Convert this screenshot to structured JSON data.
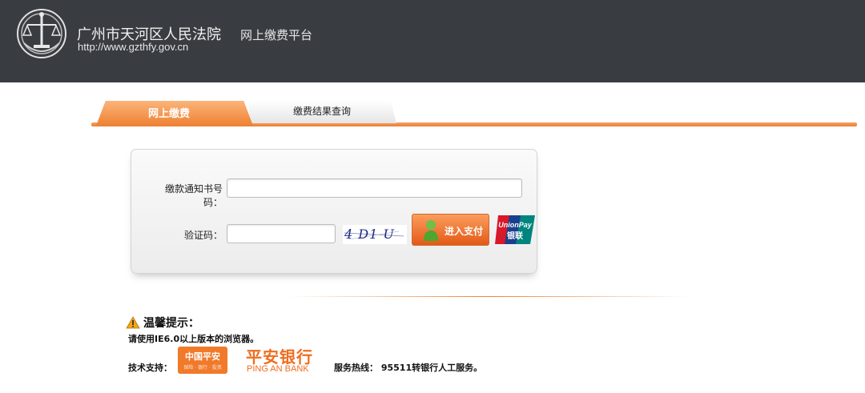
{
  "header": {
    "court_name": "广州市天河区人民法院",
    "platform_name": "网上缴费平台",
    "site_url": "http://www.gzthfy.gov.cn",
    "emblem_icon": "court-emblem-icon",
    "background": "#393c41"
  },
  "tabs": [
    {
      "label": "网上缴费",
      "active": true
    },
    {
      "label": "缴费结果查询",
      "active": false
    }
  ],
  "form": {
    "notice_label": "缴款通知书号码：",
    "notice_value": "",
    "captcha_label": "验证码：",
    "captcha_value": "",
    "captcha_text": "4 D1 U",
    "pay_button_label": "进入支付",
    "unionpay_line1": "UnionPay",
    "unionpay_line2": "银联"
  },
  "tips": {
    "title": "温馨提示：",
    "browser_note": "请使用IE6.0以上版本的浏览器。",
    "support_label": "技术支持：",
    "pingan_logo_text": "中国平安",
    "pingan_logo_sub": "保险 · 银行 · 投资",
    "bank_name_cn": "平安银行",
    "bank_name_en": "PING AN BANK",
    "hotline": "服务热线：  95511转银行人工服务。"
  },
  "colors": {
    "accent": "#ee8233",
    "bank_orange": "#ef6d1f"
  }
}
